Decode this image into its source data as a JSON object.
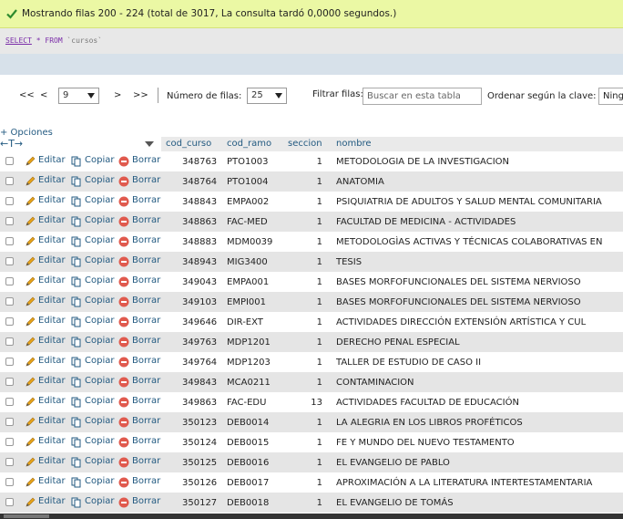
{
  "message": "Mostrando filas 200 - 224 (total de 3017, La consulta tardó 0,0000 segundos.)",
  "sql": {
    "select": "SELECT",
    "star": "*",
    "from": "FROM",
    "table": "`cursos`"
  },
  "nav": {
    "first": "<<",
    "prev": "<",
    "page": "9",
    "next": ">",
    "last": ">>",
    "rows_label": "Número de filas:",
    "rows_value": "25",
    "filter_label": "Filtrar filas:",
    "filter_placeholder": "Buscar en esta tabla",
    "sort_label": "Ordenar según la clave:",
    "sort_value": "Ning"
  },
  "options_label": "+ Opciones",
  "columns": [
    "cod_curso",
    "cod_ramo",
    "seccion",
    "nombre"
  ],
  "actions": {
    "edit": "Editar",
    "copy": "Copiar",
    "delete": "Borrar"
  },
  "colors": {
    "success_bg": "#ebf8a4",
    "link": "#235a81",
    "row_even": "#e5e5e5"
  },
  "rows": [
    {
      "cod_curso": "348763",
      "cod_ramo": "PTO1003",
      "seccion": "1",
      "nombre": "METODOLOGIA DE LA INVESTIGACION"
    },
    {
      "cod_curso": "348764",
      "cod_ramo": "PTO1004",
      "seccion": "1",
      "nombre": "ANATOMIA"
    },
    {
      "cod_curso": "348843",
      "cod_ramo": "EMPA002",
      "seccion": "1",
      "nombre": "PSIQUIATRIA DE ADULTOS Y SALUD MENTAL COMUNITARIA"
    },
    {
      "cod_curso": "348863",
      "cod_ramo": "FAC-MED",
      "seccion": "1",
      "nombre": "FACULTAD DE MEDICINA - ACTIVIDADES"
    },
    {
      "cod_curso": "348883",
      "cod_ramo": "MDM0039",
      "seccion": "1",
      "nombre": "METODOLOGÌAS ACTIVAS Y TÉCNICAS COLABORATIVAS EN"
    },
    {
      "cod_curso": "348943",
      "cod_ramo": "MIG3400",
      "seccion": "1",
      "nombre": "TESIS"
    },
    {
      "cod_curso": "349043",
      "cod_ramo": "EMPA001",
      "seccion": "1",
      "nombre": "BASES MORFOFUNCIONALES DEL SISTEMA NERVIOSO"
    },
    {
      "cod_curso": "349103",
      "cod_ramo": "EMPI001",
      "seccion": "1",
      "nombre": "BASES MORFOFUNCIONALES DEL SISTEMA NERVIOSO"
    },
    {
      "cod_curso": "349646",
      "cod_ramo": "DIR-EXT",
      "seccion": "1",
      "nombre": "ACTIVIDADES DIRECCIÓN EXTENSIÓN ARTÍSTICA Y CUL"
    },
    {
      "cod_curso": "349763",
      "cod_ramo": "MDP1201",
      "seccion": "1",
      "nombre": "DERECHO PENAL ESPECIAL"
    },
    {
      "cod_curso": "349764",
      "cod_ramo": "MDP1203",
      "seccion": "1",
      "nombre": "TALLER DE ESTUDIO DE CASO II"
    },
    {
      "cod_curso": "349843",
      "cod_ramo": "MCA0211",
      "seccion": "1",
      "nombre": "CONTAMINACION"
    },
    {
      "cod_curso": "349863",
      "cod_ramo": "FAC-EDU",
      "seccion": "13",
      "nombre": "ACTIVIDADES FACULTAD DE EDUCACIÓN"
    },
    {
      "cod_curso": "350123",
      "cod_ramo": "DEB0014",
      "seccion": "1",
      "nombre": "LA ALEGRIA EN LOS LIBROS PROFÉTICOS"
    },
    {
      "cod_curso": "350124",
      "cod_ramo": "DEB0015",
      "seccion": "1",
      "nombre": "FE Y MUNDO DEL NUEVO TESTAMENTO"
    },
    {
      "cod_curso": "350125",
      "cod_ramo": "DEB0016",
      "seccion": "1",
      "nombre": "EL EVANGELIO DE PABLO"
    },
    {
      "cod_curso": "350126",
      "cod_ramo": "DEB0017",
      "seccion": "1",
      "nombre": "APROXIMACIÓN A LA LITERATURA INTERTESTAMENTARIA"
    },
    {
      "cod_curso": "350127",
      "cod_ramo": "DEB0018",
      "seccion": "1",
      "nombre": "EL EVANGELIO DE TOMÁS"
    }
  ]
}
